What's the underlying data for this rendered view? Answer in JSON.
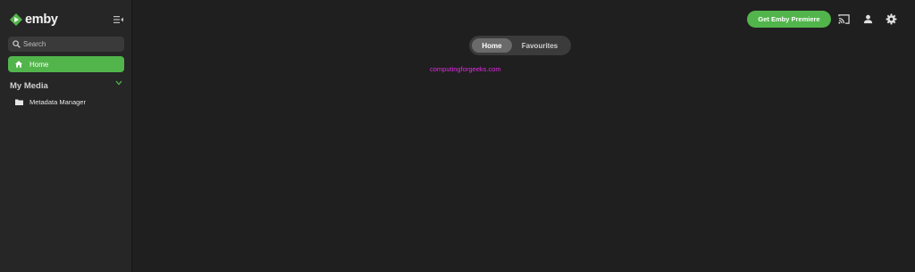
{
  "brand": {
    "name": "emby"
  },
  "sidebar": {
    "search": {
      "placeholder": "Search"
    },
    "home": {
      "label": "Home"
    },
    "section": {
      "title": "My Media"
    },
    "libraries": [
      {
        "label": "Metadata Manager"
      }
    ]
  },
  "header": {
    "premiere_label": "Get Emby Premiere"
  },
  "tabs": [
    {
      "label": "Home",
      "active": true
    },
    {
      "label": "Favourites",
      "active": false
    }
  ],
  "watermark": "computingforgeeks.com",
  "colors": {
    "accent": "#52b54b",
    "background": "#1f1f1f",
    "sidebar": "#262626",
    "watermark": "#e32be3"
  }
}
